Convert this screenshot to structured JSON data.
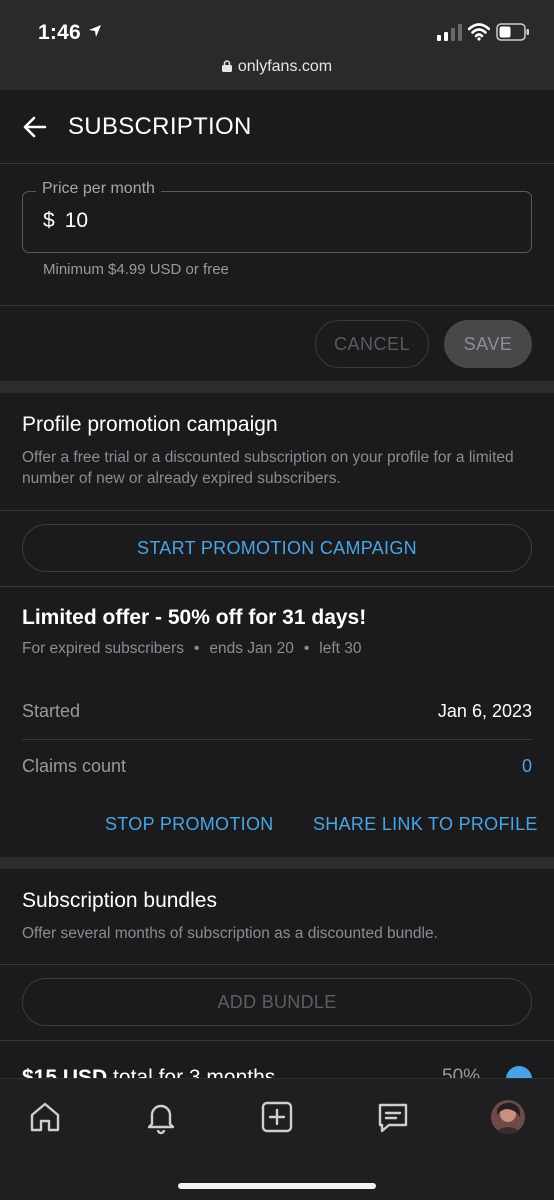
{
  "status_bar": {
    "time": "1:46",
    "url": "onlyfans.com"
  },
  "header": {
    "title": "SUBSCRIPTION"
  },
  "price": {
    "legend": "Price per month",
    "currency": "$",
    "value": "10",
    "helper": "Minimum $4.99 USD or free",
    "cancel_label": "CANCEL",
    "save_label": "SAVE"
  },
  "promotion": {
    "title": "Profile promotion campaign",
    "description": "Offer a free trial or a discounted subscription on your profile for a limited number of new or already expired subscribers.",
    "start_label": "START PROMOTION CAMPAIGN"
  },
  "offer": {
    "title": "Limited offer - 50% off for 31 days!",
    "audience": "For expired subscribers",
    "ends": "ends Jan 20",
    "left": "left 30",
    "separator": "•",
    "started_label": "Started",
    "started_value": "Jan 6, 2023",
    "claims_label": "Claims count",
    "claims_value": "0",
    "stop_label": "STOP PROMOTION",
    "share_label": "SHARE LINK TO PROFILE"
  },
  "bundles": {
    "title": "Subscription bundles",
    "description": "Offer several months of subscription as a discounted bundle.",
    "add_label": "ADD BUNDLE",
    "item": {
      "amount": "$15 USD",
      "rest": " total for 3 months",
      "discount": "50%"
    }
  },
  "nav": {
    "items": [
      "home-icon",
      "bell-icon",
      "plus-square-icon",
      "message-icon",
      "avatar"
    ]
  },
  "colors": {
    "background": "#1b1b1d",
    "accent": "#4aa4e4",
    "muted_text": "#8d8d91"
  }
}
